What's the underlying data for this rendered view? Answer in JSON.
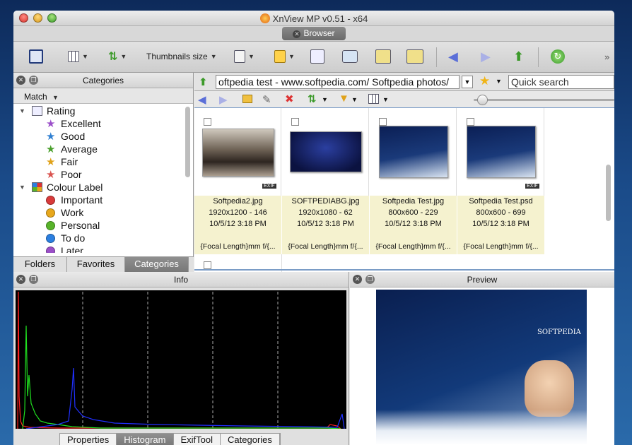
{
  "window": {
    "title": "XnView MP v0.51 - x64",
    "tab": "Browser"
  },
  "toolbar": {
    "thumbnails_size": "Thumbnails size"
  },
  "categories_pane": {
    "title": "Categories",
    "match": "Match",
    "tree": [
      {
        "label": "Rating",
        "type": "group",
        "icon": "rating-icon"
      },
      {
        "label": "Excellent",
        "type": "star",
        "color": "#9b4fc9"
      },
      {
        "label": "Good",
        "type": "star",
        "color": "#2f7fd1"
      },
      {
        "label": "Average",
        "type": "star",
        "color": "#4aa02c"
      },
      {
        "label": "Fair",
        "type": "star",
        "color": "#e0a21a"
      },
      {
        "label": "Poor",
        "type": "star",
        "color": "#d9534f"
      },
      {
        "label": "Colour Label",
        "type": "group",
        "icon": "colour-label-icon"
      },
      {
        "label": "Important",
        "type": "dot",
        "color": "#d83a3a"
      },
      {
        "label": "Work",
        "type": "dot",
        "color": "#e8a81c"
      },
      {
        "label": "Personal",
        "type": "dot",
        "color": "#58b32a"
      },
      {
        "label": "To do",
        "type": "dot",
        "color": "#2b7fe0"
      },
      {
        "label": "Later",
        "type": "dot",
        "color": "#9a4fc7"
      }
    ],
    "tabs": [
      "Folders",
      "Favorites",
      "Categories"
    ],
    "active_tab": "Categories"
  },
  "browser": {
    "address": "oftpedia test - www.softpedia.com/ Softpedia photos/",
    "quick_search_placeholder": "Quick search",
    "thumbnails": [
      {
        "name": "Softpedia2.jpg",
        "dims": "1920x1200 - 146",
        "date": "10/5/12 3:18 PM",
        "focal": "{Focal Length}mm f/{...",
        "exif": "EXIF"
      },
      {
        "name": "SOFTPEDIABG.jpg",
        "dims": "1920x1080 - 62",
        "date": "10/5/12 3:18 PM",
        "focal": "{Focal Length}mm f/{...",
        "exif": ""
      },
      {
        "name": "Softpedia Test.jpg",
        "dims": "800x600 - 229",
        "date": "10/5/12 3:18 PM",
        "focal": "{Focal Length}mm f/{...",
        "exif": ""
      },
      {
        "name": "Softpedia Test.psd",
        "dims": "800x600 - 699",
        "date": "10/5/12 3:18 PM",
        "focal": "{Focal Length}mm f/{...",
        "exif": "EXIF"
      }
    ]
  },
  "info_pane": {
    "title": "Info",
    "tabs": [
      "Properties",
      "Histogram",
      "ExifTool",
      "Categories"
    ],
    "active_tab": "Histogram"
  },
  "preview_pane": {
    "title": "Preview",
    "brand": "SOFTPEDIA"
  },
  "colors": {
    "accent": "#7a9cc6",
    "tab_active": "#808080"
  }
}
